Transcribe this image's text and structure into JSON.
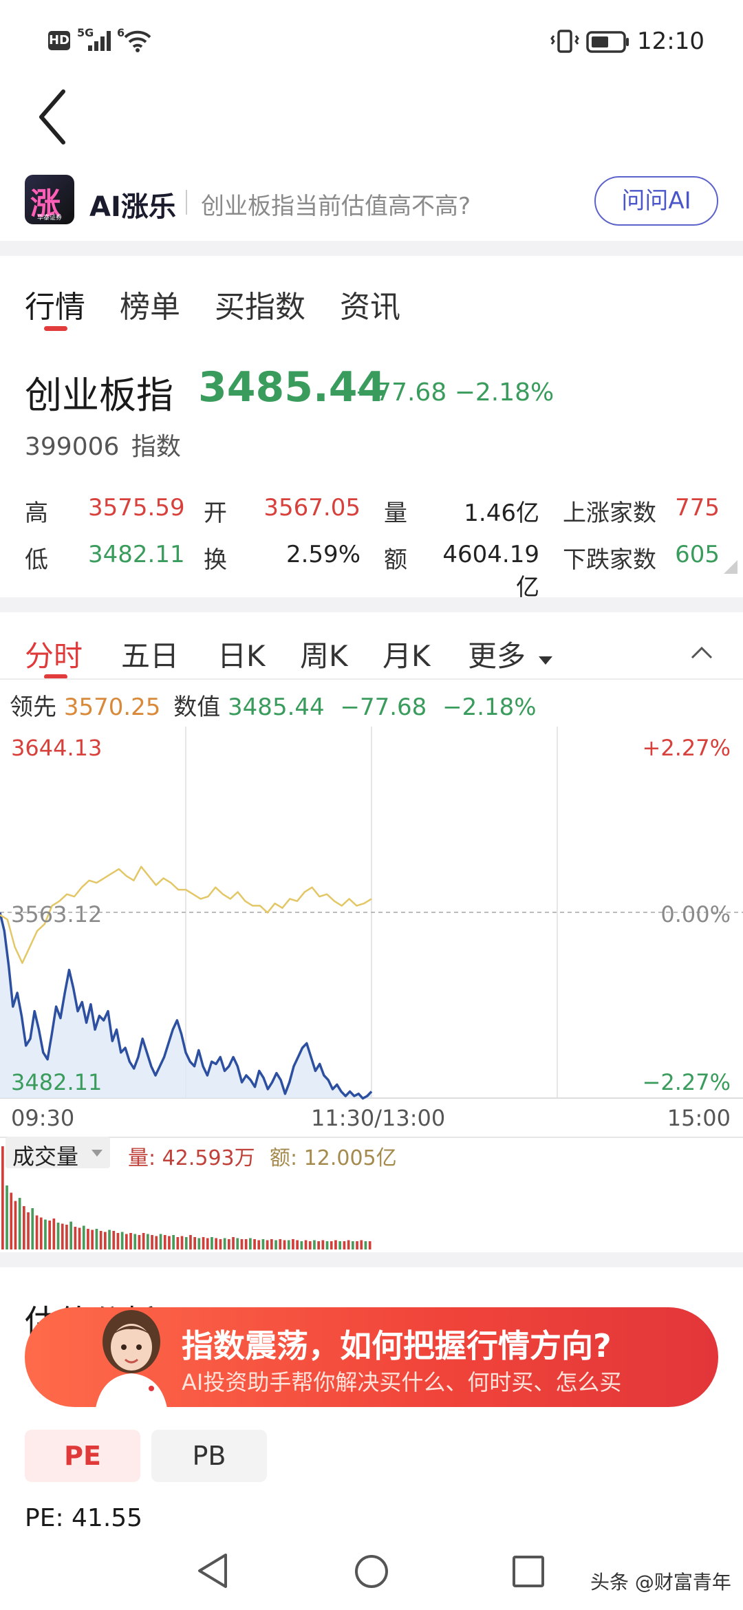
{
  "status_bar": {
    "hd": "HD",
    "signal_5g": "5G",
    "wifi_6": "6",
    "time": "12:10"
  },
  "ai_banner": {
    "logo_char": "涨",
    "logo_caption": "华泰证券",
    "title": "AI涨乐",
    "question": "创业板指当前估值高不高?",
    "ask_button": "问问AI"
  },
  "main_tabs": [
    "行情",
    "榜单",
    "买指数",
    "资讯"
  ],
  "quote": {
    "name": "创业板指",
    "price": "3485.44",
    "change": "−77.68",
    "change_pct": "−2.18%",
    "code": "399006",
    "type": "指数",
    "stats": [
      {
        "label": "高",
        "value": "3575.59",
        "color": "red"
      },
      {
        "label": "开",
        "value": "3567.05",
        "color": "red"
      },
      {
        "label": "量",
        "value": "1.46亿",
        "color": "black"
      },
      {
        "label": "上涨家数",
        "value": "775",
        "color": "red"
      },
      {
        "label": "低",
        "value": "3482.11",
        "color": "green"
      },
      {
        "label": "换",
        "value": "2.59%",
        "color": "black"
      },
      {
        "label": "额",
        "value": "4604.19亿",
        "color": "black"
      },
      {
        "label": "下跌家数",
        "value": "605",
        "color": "green"
      }
    ]
  },
  "chart_tabs": [
    "分时",
    "五日",
    "日K",
    "周K",
    "月K",
    "更多"
  ],
  "lead_row": {
    "lead_label": "领先",
    "lead_value": "3570.25",
    "num_label": "数值",
    "num_value": "3485.44",
    "num_change": "−77.68",
    "num_pct": "−2.18%"
  },
  "chart_labels": {
    "high": "3644.13",
    "mid": "3563.12",
    "low": "3482.11",
    "pct_high": "+2.27%",
    "pct_mid": "0.00%",
    "pct_low": "−2.27%",
    "time_start": "09:30",
    "time_mid": "11:30/13:00",
    "time_end": "15:00"
  },
  "chart_data": {
    "type": "line",
    "ylim": [
      3482.11,
      3644.13
    ],
    "x_ticks": [
      "09:30",
      "11:30/13:00",
      "15:00"
    ],
    "y_ticks": [
      "3644.13",
      "3563.12",
      "3482.11"
    ],
    "y_ticks_pct": [
      "+2.27%",
      "0.00%",
      "−2.27%"
    ],
    "series": [
      {
        "color": "#2d4fa0",
        "values": [
          3563,
          3555,
          3540,
          3522,
          3528,
          3518,
          3505,
          3508,
          3520,
          3512,
          3502,
          3499,
          3510,
          3522,
          3517,
          3528,
          3538,
          3530,
          3520,
          3524,
          3515,
          3523,
          3512,
          3518,
          3516,
          3520,
          3507,
          3512,
          3502,
          3504,
          3498,
          3495,
          3500,
          3508,
          3502,
          3496,
          3492,
          3496,
          3500,
          3506,
          3512,
          3516,
          3510,
          3502,
          3498,
          3496,
          3503,
          3496,
          3492,
          3498,
          3497,
          3500,
          3494,
          3496,
          3500,
          3496,
          3489,
          3492,
          3490,
          3487,
          3494,
          3491,
          3486,
          3489,
          3493,
          3490,
          3484,
          3489,
          3496,
          3500,
          3504,
          3506,
          3500,
          3494,
          3497,
          3492,
          3490,
          3486,
          3488,
          3485,
          3483,
          3485,
          3483,
          3484,
          3482,
          3483,
          3485
        ]
      },
      {
        "color": "#e3c766",
        "values": [
          3562,
          3560,
          3548,
          3541,
          3548,
          3555,
          3558,
          3566,
          3568,
          3571,
          3570,
          3574,
          3577,
          3576,
          3578,
          3580,
          3582,
          3579,
          3577,
          3583,
          3579,
          3575,
          3578,
          3576,
          3573,
          3573,
          3571,
          3569,
          3570,
          3574,
          3571,
          3569,
          3572,
          3568,
          3566,
          3566,
          3563,
          3567,
          3565,
          3569,
          3568,
          3572,
          3574,
          3570,
          3571,
          3568,
          3566,
          3569,
          3566,
          3567,
          3569
        ]
      }
    ]
  },
  "volume": {
    "label": "成交量",
    "qty_label": "量:",
    "qty": "42.593万",
    "amt_label": "额:",
    "amt": "12.005亿",
    "bars": [
      1,
      0.62,
      0.55,
      0.47,
      0.5,
      0.42,
      0.36,
      0.4,
      0.33,
      0.31,
      0.29,
      0.28,
      0.3,
      0.26,
      0.25,
      0.24,
      0.27,
      0.22,
      0.21,
      0.23,
      0.2,
      0.19,
      0.2,
      0.18,
      0.17,
      0.19,
      0.18,
      0.16,
      0.17,
      0.15,
      0.16,
      0.15,
      0.14,
      0.16,
      0.15,
      0.14,
      0.13,
      0.15,
      0.14,
      0.13,
      0.14,
      0.12,
      0.13,
      0.12,
      0.14,
      0.12,
      0.11,
      0.12,
      0.11,
      0.12,
      0.11,
      0.1,
      0.11,
      0.1,
      0.12,
      0.11,
      0.1,
      0.1,
      0.11,
      0.1,
      0.09,
      0.1,
      0.09,
      0.1,
      0.09,
      0.1,
      0.09,
      0.09,
      0.1,
      0.09,
      0.08,
      0.09,
      0.08,
      0.09,
      0.08,
      0.09,
      0.08,
      0.08,
      0.09,
      0.08,
      0.08,
      0.09,
      0.08,
      0.08,
      0.09,
      0.08,
      0.08
    ]
  },
  "promo": {
    "title": "指数震荡，如何把握行情方向?",
    "subtitle": "AI投资助手帮你解决买什么、何时买、怎么买"
  },
  "valuation": {
    "section_title": "估值分析",
    "pe_tab": "PE",
    "pb_tab": "PB",
    "pe_value": "PE: 41.55"
  },
  "watermark": "头条 @财富青年"
}
